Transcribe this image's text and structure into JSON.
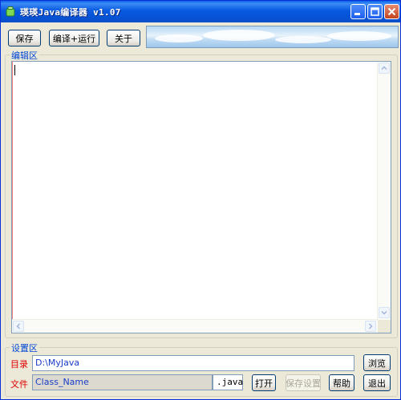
{
  "window": {
    "title": "瑛瑛Java编译器 v1.07",
    "controls": {
      "minimize": "minimize-icon",
      "maximize": "maximize-icon",
      "close": "close-icon"
    }
  },
  "toolbar": {
    "save_label": "保存",
    "compile_run_label": "编译+运行",
    "about_label": "关于"
  },
  "editor": {
    "group_label": "编辑区",
    "content": ""
  },
  "settings": {
    "group_label": "设置区",
    "dir_label": "目录",
    "dir_value": "D:\\MyJava",
    "browse_label": "浏览",
    "file_label": "文件",
    "file_value": "Class_Name",
    "file_ext": ".java",
    "open_label": "打开",
    "save_settings_label": "保存设置",
    "help_label": "帮助",
    "exit_label": "退出"
  },
  "colors": {
    "titlebar": "#0a5ae0",
    "group_label": "#0046d5",
    "field_label": "#e00000",
    "field_text": "#1a3cc8"
  }
}
